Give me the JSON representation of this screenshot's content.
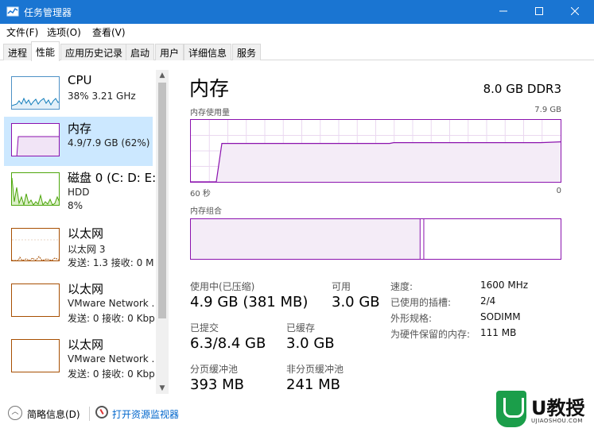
{
  "window": {
    "title": "任务管理器",
    "controls": [
      "minimize-icon",
      "maximize-icon",
      "close-icon"
    ]
  },
  "menu": [
    "文件(F)",
    "选项(O)",
    "查看(V)"
  ],
  "tabs": [
    {
      "label": "进程",
      "active": false
    },
    {
      "label": "性能",
      "active": true
    },
    {
      "label": "应用历史记录",
      "active": false
    },
    {
      "label": "启动",
      "active": false
    },
    {
      "label": "用户",
      "active": false
    },
    {
      "label": "详细信息",
      "active": false
    },
    {
      "label": "服务",
      "active": false
    }
  ],
  "sidebar": {
    "items": [
      {
        "name": "CPU",
        "sub1": "38% 3.21 GHz",
        "sub2": "",
        "sub3": "",
        "selected": false
      },
      {
        "name": "内存",
        "sub1": "4.9/7.9 GB (62%)",
        "sub2": "",
        "sub3": "",
        "selected": true
      },
      {
        "name": "磁盘 0 (C: D: E:",
        "sub1": "HDD",
        "sub2": "8%",
        "sub3": "",
        "selected": false
      },
      {
        "name": "以太网",
        "sub1": "以太网 3",
        "sub2": "发送: 1.3  接收: 0 M",
        "sub3": "",
        "selected": false
      },
      {
        "name": "以太网",
        "sub1": "VMware Network .",
        "sub2": "发送: 0  接收: 0 Kbp",
        "sub3": "",
        "selected": false
      },
      {
        "name": "以太网",
        "sub1": "VMware Network .",
        "sub2": "发送: 0  接收: 0 Kbp",
        "sub3": "",
        "selected": false
      }
    ]
  },
  "main": {
    "title": "内存",
    "spec": "8.0 GB DDR3",
    "usage_graph": {
      "label": "内存使用量",
      "max_label": "7.9 GB",
      "time_label": "60 秒",
      "min_label": "0",
      "usage_fraction": 0.62
    },
    "composition": {
      "label": "内存组合",
      "in_use_fraction": 0.62,
      "modified_fraction": 0.01
    },
    "stats": {
      "in_use_label": "使用中(已压缩)",
      "in_use_value": "4.9 GB (381 MB)",
      "available_label": "可用",
      "available_value": "3.0 GB",
      "committed_label": "已提交",
      "committed_value": "6.3/8.4 GB",
      "cached_label": "已缓存",
      "cached_value": "3.0 GB",
      "paged_label": "分页缓冲池",
      "paged_value": "393 MB",
      "nonpaged_label": "非分页缓冲池",
      "nonpaged_value": "241 MB"
    },
    "properties": [
      {
        "label": "速度:",
        "value": "1600 MHz"
      },
      {
        "label": "已使用的插槽:",
        "value": "2/4"
      },
      {
        "label": "外形规格:",
        "value": "SODIMM"
      },
      {
        "label": "为硬件保留的内存:",
        "value": "111 MB"
      }
    ]
  },
  "footer": {
    "brief_label": "简略信息(D)",
    "monitor_link": "打开资源监视器"
  },
  "watermark": {
    "brand": "U教授",
    "site": "UJIAOSHOU.COM"
  },
  "colors": {
    "titlebar": "#1a75d2",
    "memory": "#8b12ae",
    "cpu": "#117dbb",
    "disk": "#4da60c",
    "ethernet": "#a74f01",
    "selected": "#cce8ff"
  }
}
